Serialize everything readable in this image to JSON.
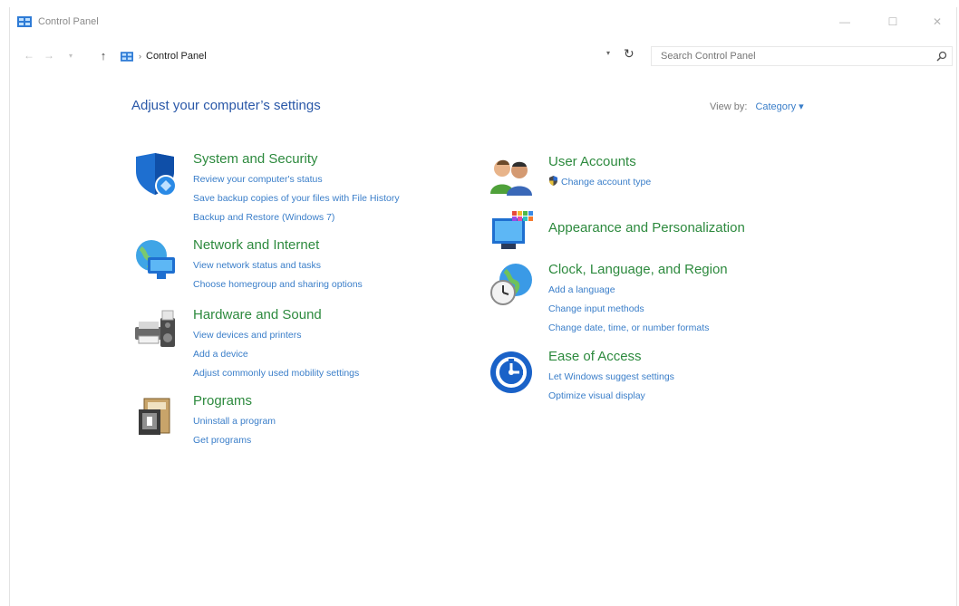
{
  "window": {
    "title": "Control Panel",
    "controls": {
      "minimize": "—",
      "maximize": "☐",
      "close": "✕"
    }
  },
  "navigation": {
    "back": "←",
    "forward": "→",
    "recent": "▾",
    "up": "↑",
    "breadcrumb": "Control Panel",
    "breadcrumb_sep": "›",
    "dropdown": "▾",
    "refresh": "↻",
    "search_placeholder": "Search Control Panel"
  },
  "content": {
    "heading": "Adjust your computer’s settings",
    "view_by_label": "View by:",
    "view_by_value": "Category ▾",
    "left_categories": [
      {
        "title": "System and Security",
        "icon": "shield-icon",
        "links": [
          "Review your computer's status",
          "Save backup copies of your files with File History",
          "Backup and Restore (Windows 7)"
        ]
      },
      {
        "title": "Network and Internet",
        "icon": "globe-network-icon",
        "links": [
          "View network status and tasks",
          "Choose homegroup and sharing options"
        ]
      },
      {
        "title": "Hardware and Sound",
        "icon": "printer-speaker-icon",
        "links": [
          "View devices and printers",
          "Add a device",
          "Adjust commonly used mobility settings"
        ]
      },
      {
        "title": "Programs",
        "icon": "programs-icon",
        "links": [
          "Uninstall a program",
          "Get programs"
        ]
      }
    ],
    "right_categories": [
      {
        "title": "User Accounts",
        "icon": "users-icon",
        "links": [
          "Change account type"
        ]
      },
      {
        "title": "Appearance and Personalization",
        "icon": "monitor-palette-icon",
        "links": []
      },
      {
        "title": "Clock, Language, and Region",
        "icon": "clock-globe-icon",
        "links": [
          "Add a language",
          "Change input methods",
          "Change date, time, or number formats"
        ]
      },
      {
        "title": "Ease of Access",
        "icon": "ease-of-access-icon",
        "links": [
          "Let Windows suggest settings",
          "Optimize visual display"
        ]
      }
    ]
  },
  "colors": {
    "heading": "#2a58a8",
    "category_title": "#2d8a3e",
    "link": "#3a7ec9"
  }
}
